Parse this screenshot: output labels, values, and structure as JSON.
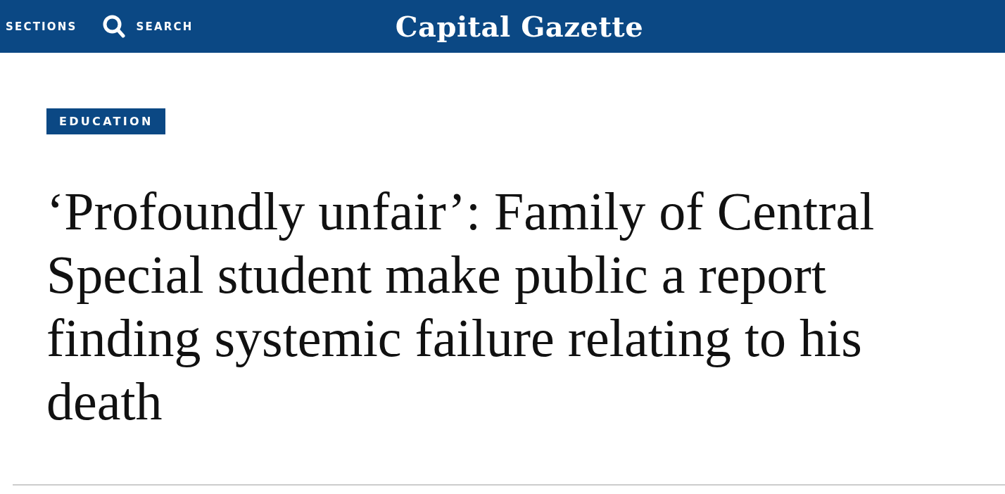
{
  "header": {
    "sections_label": "SECTIONS",
    "search_label": "SEARCH",
    "logo": "Capital Gazette"
  },
  "article": {
    "category": "EDUCATION",
    "headline": "‘Profoundly unfair’: Family of Central Special student make public a report finding systemic failure relating to his death"
  }
}
